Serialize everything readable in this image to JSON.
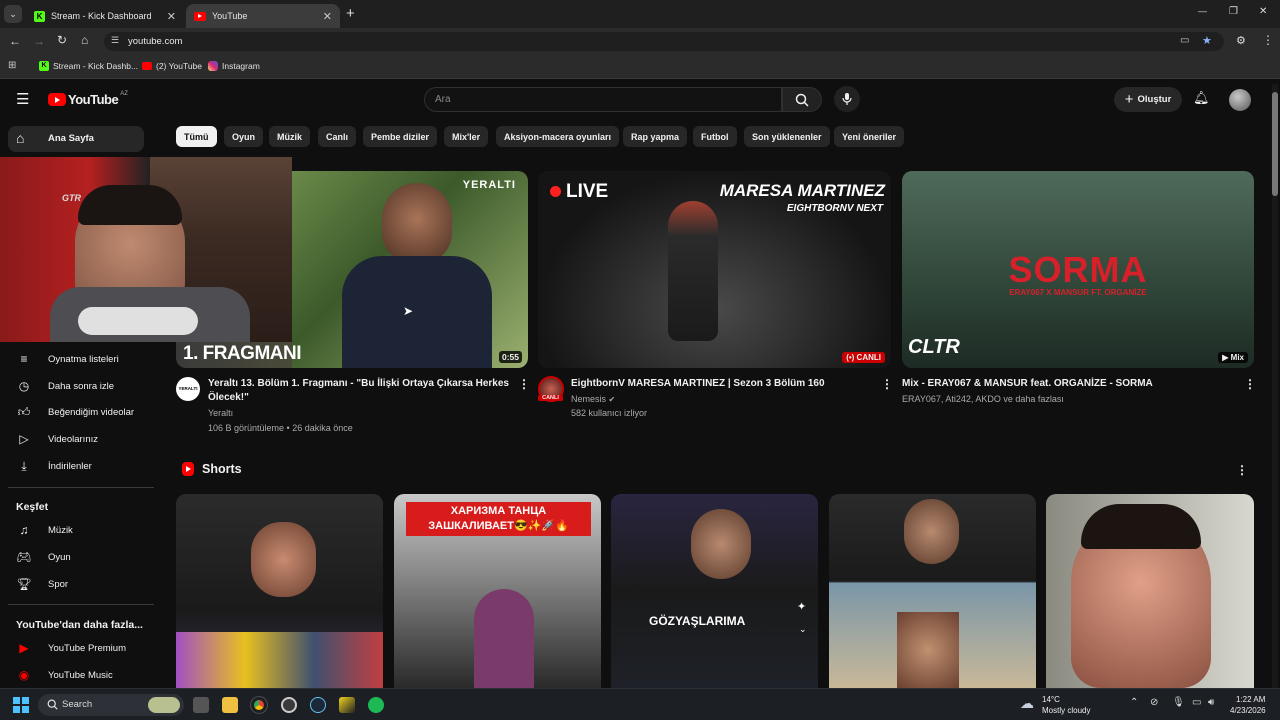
{
  "browser": {
    "tabs": [
      {
        "label": "Stream - Kick Dashboard",
        "active": false
      },
      {
        "label": "YouTube",
        "active": true
      }
    ],
    "new_tab": "+",
    "url": "youtube.com",
    "bookmarks": [
      "Stream - Kick Dashb...",
      "(2) YouTube",
      "Instagram"
    ],
    "window": {
      "minimize": "—",
      "restore": "❐",
      "close": "✕"
    }
  },
  "youtube": {
    "logo_text": "YouTube",
    "region": "AZ",
    "search_placeholder": "Ara",
    "create_label": "Oluştur",
    "chips": [
      "Tümü",
      "Oyun",
      "Müzik",
      "Canlı",
      "Pembe diziler",
      "Mix'ler",
      "Aksiyon-macera oyunları",
      "Rap yapma",
      "Futbol",
      "Son yüklenenler",
      "Yeni öneriler"
    ],
    "sidebar": {
      "home": "Ana Sayfa",
      "you_items": [
        "Oynatma listeleri",
        "Daha sonra izle",
        "Beğendiğim videolar",
        "Videolarınız",
        "İndirilenler"
      ],
      "explore_title": "Keşfet",
      "explore_items": [
        "Müzik",
        "Oyun",
        "Spor"
      ],
      "more_title": "YouTube'dan daha fazla...",
      "more_items": [
        "YouTube Premium",
        "YouTube Music"
      ]
    },
    "videos": [
      {
        "thumb_text": "1. FRAGMANI",
        "thumb_brand": "YERALTI",
        "duration": "0:55",
        "avatar": "YERALTI",
        "title": "Yeraltı 13. Bölüm 1. Fragmanı - \"Bu İlişki Ortaya Çıkarsa Herkes Ölecek!\"",
        "channel": "Yeraltı",
        "meta": "106 B görüntüleme • 26 dakika önce"
      },
      {
        "thumb_live": "LIVE",
        "thumb_title": "MARESA MARTINEZ",
        "thumb_sub": "EIGHTBORNV NEXT",
        "badge": "CANLI",
        "avatar_badge": "CANLI",
        "title": "EightbornV MARESA MARTINEZ | Sezon 3 Bölüm 160",
        "channel": "Nemesis",
        "meta": "582 kullanıcı izliyor"
      },
      {
        "thumb_title": "SORMA",
        "thumb_sub": "ERAY067 X MANSUR FT. ORGANİZE",
        "thumb_brand": "CLTR",
        "badge": "Mix",
        "title": "Mix - ERAY067 & MANSUR feat. ORGANİZE - SORMA",
        "channel": "ERAY067, Ati242, AKDO ve daha fazlası"
      }
    ],
    "shorts_title": "Shorts",
    "shorts": [
      {
        "caption": ""
      },
      {
        "caption": "ХАРИЗМА ТАНЦА ЗАШКАЛИВАЕТ😎✨🚀🔥"
      },
      {
        "caption": "GÖZYAŞLARIMA"
      },
      {
        "caption": ""
      },
      {
        "caption": ""
      }
    ]
  },
  "taskbar": {
    "search_label": "Search",
    "weather_temp": "14°C",
    "weather_desc": "Mostly cloudy",
    "time": "1:22 AM",
    "date": "4/23/2026"
  },
  "colors": {
    "accent": "#ff0000",
    "bg": "#0f0f0f",
    "chip": "#272727",
    "kick": "#53fc18"
  }
}
